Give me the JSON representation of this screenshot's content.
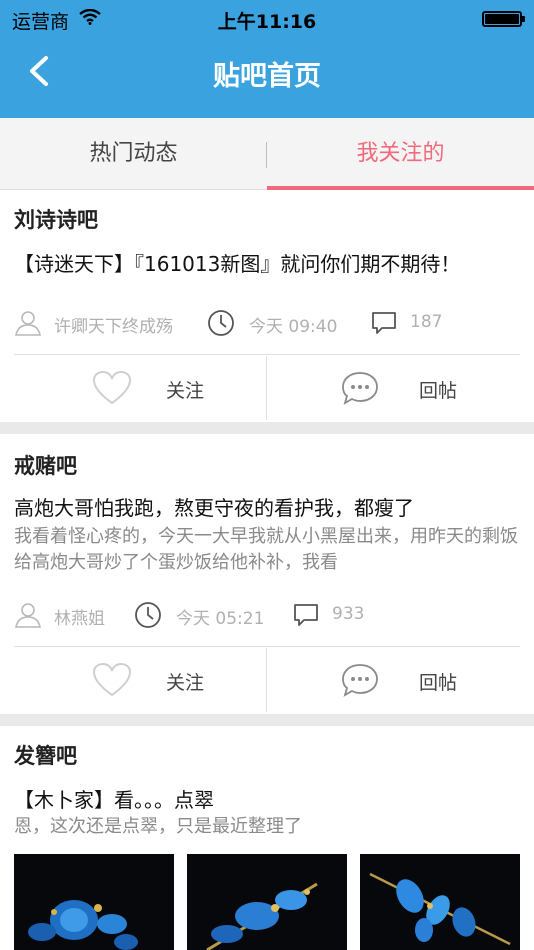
{
  "status_bar": {
    "carrier": "运营商",
    "time": "上午11:16"
  },
  "navbar": {
    "title": "贴吧首页"
  },
  "tabs": [
    {
      "label": "热门动态"
    },
    {
      "label": "我关注的"
    }
  ],
  "posts": [
    {
      "forum": "刘诗诗吧",
      "title": "【诗迷天下】『161013新图』就问你们期不期待！",
      "summary": "",
      "author": "许卿天下终成殇",
      "time": "今天 09:40",
      "replies": "187",
      "follow_label": "关注",
      "reply_label": "回帖"
    },
    {
      "forum": "戒赌吧",
      "title": "高炮大哥怕我跑，熬更守夜的看护我，都瘦了",
      "summary": "我看着怪心疼的，今天一大早我就从小黑屋出来，用昨天的剩饭给高炮大哥炒了个蛋炒饭给他补补，我看",
      "author": "林燕姐",
      "time": "今天 05:21",
      "replies": "933",
      "follow_label": "关注",
      "reply_label": "回帖"
    },
    {
      "forum": "发簪吧",
      "title": "【木卜家】看。。。点翠",
      "summary": "恩，这次还是点翠，只是最近整理了"
    }
  ],
  "colors": {
    "brand_blue": "#3aa3df",
    "accent_pink": "#ef6a7d"
  },
  "icons": [
    "back-arrow-icon",
    "wifi-icon",
    "battery-icon",
    "user-icon",
    "clock-icon",
    "comment-icon",
    "heart-icon",
    "chat-bubble-icon"
  ]
}
